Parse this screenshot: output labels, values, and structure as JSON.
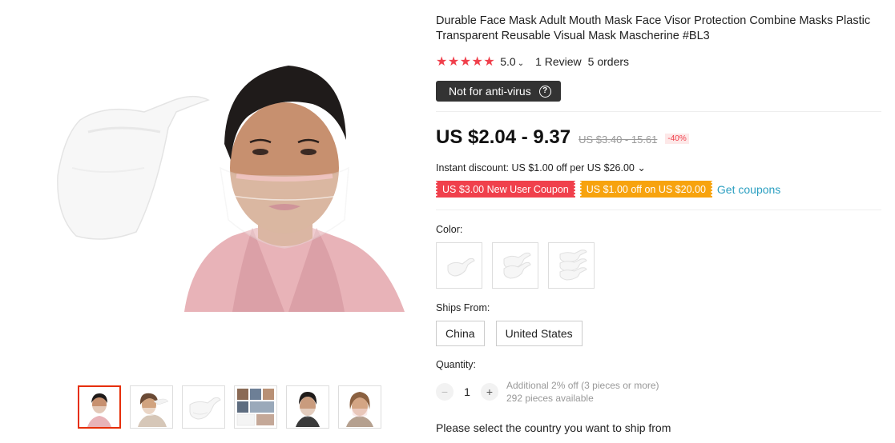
{
  "product": {
    "title": "Durable Face Mask Adult Mouth Mask Face Visor Protection Combine Masks Plastic Transparent Reusable Visual Mask Mascherine #BL3",
    "rating": {
      "stars": "★★★★★",
      "value": "5.0",
      "chevron": "⌄",
      "reviews": "1 Review",
      "orders": "5 orders"
    },
    "notice": {
      "label": "Not for anti-virus",
      "icon": "question-icon",
      "icon_glyph": "?"
    },
    "price": {
      "current": "US $2.04 - 9.37",
      "original": "US $3.40 - 15.61",
      "discount": "-40%"
    },
    "instant_discount": "Instant discount: US $1.00 off per US $26.00 ⌄",
    "coupons": [
      {
        "label": "US $3.00 New User Coupon",
        "color": "#f0404c"
      },
      {
        "label": "US $1.00 off on US $20.00",
        "color": "#f7a30e"
      }
    ],
    "get_coupons": "Get coupons",
    "color_label": "Color:",
    "color_options": [
      {
        "name": "single-mask"
      },
      {
        "name": "two-masks"
      },
      {
        "name": "three-masks"
      }
    ],
    "ships_from_label": "Ships From:",
    "ships_from": [
      "China",
      "United States"
    ],
    "quantity_label": "Quantity:",
    "quantity": {
      "minus": "−",
      "value": "1",
      "plus": "+",
      "note1": "Additional 2% off (3 pieces or more)",
      "note2": "292 pieces available"
    },
    "ship_country": "Please select the country you want to ship from"
  },
  "gallery": {
    "thumbnails": [
      {
        "name": "woman-wearing-mask"
      },
      {
        "name": "woman-side-mask"
      },
      {
        "name": "mask-product"
      },
      {
        "name": "mask-collage"
      },
      {
        "name": "woman-front-mask"
      },
      {
        "name": "woman-smiling-mask"
      }
    ],
    "active_index": 0
  },
  "colors": {
    "accent_red": "#f0404c",
    "accent_orange": "#f7a30e",
    "link_blue": "#2b9fc1",
    "active_border": "#e62e04"
  }
}
